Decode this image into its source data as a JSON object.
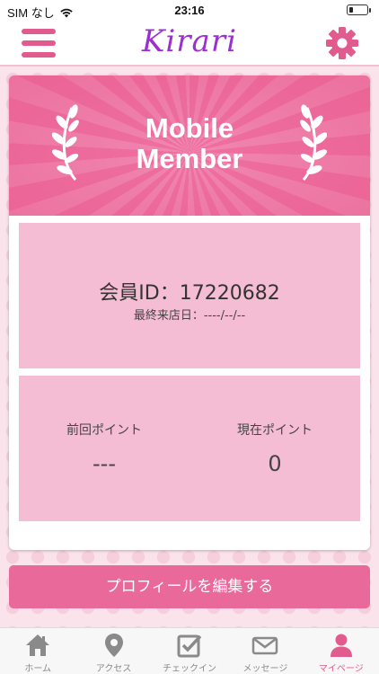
{
  "status_bar": {
    "carrier": "SIM なし",
    "time": "23:16"
  },
  "header": {
    "logo_text": "Kirari",
    "icons": [
      "menu-icon",
      "gear-icon"
    ]
  },
  "member_card": {
    "banner_title_line1": "Mobile",
    "banner_title_line2": "Member",
    "member_id_label": "会員ID：",
    "member_id_value": "17220682",
    "last_visit_label": "最終来店日：",
    "last_visit_value": "----/--/--",
    "previous_points_label": "前回ポイント",
    "previous_points_value": "---",
    "current_points_label": "現在ポイント",
    "current_points_value": "0"
  },
  "edit_profile_button": "プロフィールを編集する",
  "tab_bar": {
    "tabs": [
      {
        "label": "ホーム",
        "icon": "home-icon"
      },
      {
        "label": "アクセス",
        "icon": "map-pin-icon"
      },
      {
        "label": "チェックイン",
        "icon": "checkin-icon"
      },
      {
        "label": "メッセージ",
        "icon": "mail-icon"
      },
      {
        "label": "マイページ",
        "icon": "user-icon"
      }
    ],
    "active_tab": "マイページ"
  },
  "colors": {
    "accent_pink": "#e25b8f",
    "logo_purple": "#9b2fcf",
    "panel_pink": "#f5bdd4",
    "button_pink": "#e8699a"
  }
}
